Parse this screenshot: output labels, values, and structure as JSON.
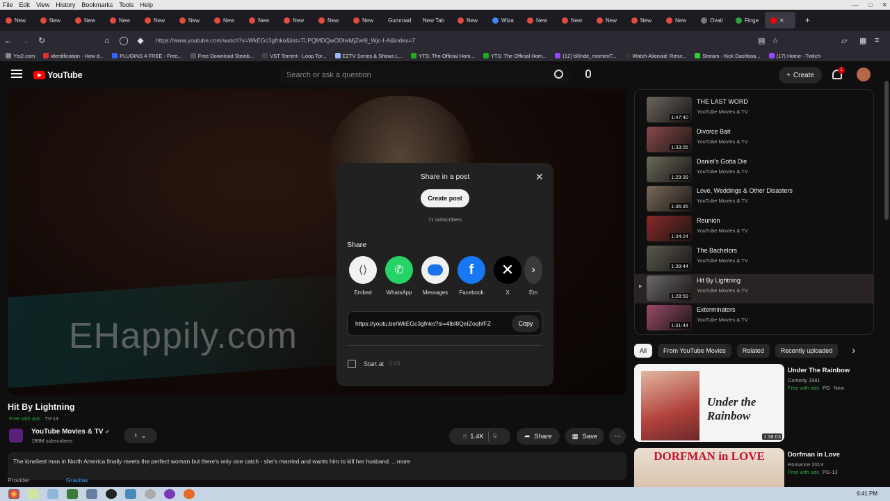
{
  "menubar": {
    "items": [
      "File",
      "Edit",
      "View",
      "History",
      "Bookmarks",
      "Tools",
      "Help"
    ]
  },
  "tabs": [
    "New",
    "New",
    "New",
    "New",
    "New",
    "New",
    "New",
    "New",
    "New",
    "New",
    "New",
    "Gumroad",
    "New Tab",
    "New",
    "Wiza",
    "New",
    "New",
    "New",
    "New",
    "New",
    "Ovati",
    "Finge"
  ],
  "browser": {
    "url": "https://www.youtube.com/watch?v=WkEGc3gfnko&list=TLPQMDQwODIwMjZwi9_Wjc-I-A&index=7"
  },
  "bookmarks": [
    "Yts2.com",
    "identification - How d...",
    "PLUGINS 4 FREE - Free...",
    "Free Download Steinb...",
    "VST Torrent - Loop Tor...",
    "EZTV Series & Shows L...",
    "YTS: The Official Hom...",
    "YTS: The Official Hom...",
    "(12) bl0nde_momenT...",
    "Watch Alienoid: Retur...",
    "Stream - Kick Dashboa...",
    "(17) Home - Twitch"
  ],
  "header": {
    "logo": "YouTube",
    "search_placeholder": "Search or ask a question",
    "create": "Create",
    "notif_count": "1"
  },
  "video": {
    "watermark": "EHappily.com",
    "title": "Hit By Lightning",
    "free": "Free with ads",
    "rating": "TV-14",
    "channel": "YouTube Movies & TV",
    "subs": "199M subscribers",
    "likes": "1.4K",
    "share": "Share",
    "save": "Save",
    "description": "The loneliest man in North America finally meets the perfect woman but there's only one catch - she's married and wants him to kill her husband. ...more",
    "provider_label": "Provider",
    "provider": "Gravitas"
  },
  "modal": {
    "title": "Share in a post",
    "create_post": "Create post",
    "subs": "71 subscribers",
    "share_label": "Share",
    "targets": [
      {
        "label": "Embed",
        "color": "#f1f1f1"
      },
      {
        "label": "WhatsApp",
        "color": "#25d366"
      },
      {
        "label": "Messages",
        "color": "#1a73e8"
      },
      {
        "label": "Facebook",
        "color": "#1877f2"
      },
      {
        "label": "X",
        "color": "#000000"
      },
      {
        "label": "Em",
        "color": "#3a3a3a"
      }
    ],
    "link": "https://youtu.be/WkEGc3gfnko?si=4lbI8QeIZoqhfFZ",
    "copy": "Copy",
    "start_at": "Start at",
    "start_time": "0:03"
  },
  "playlist": [
    {
      "title": "THE LAST WORD",
      "channel": "YouTube Movies & TV",
      "duration": "1:47:40",
      "thumb": "#6b6560"
    },
    {
      "title": "Divorce Bait",
      "channel": "YouTube Movies & TV",
      "duration": "1:33:05",
      "thumb": "#8a4a4a"
    },
    {
      "title": "Daniel's Gotta Die",
      "channel": "YouTube Movies & TV",
      "duration": "1:29:39",
      "thumb": "#6a6a5a"
    },
    {
      "title": "Love, Weddings & Other Disasters",
      "channel": "YouTube Movies & TV",
      "duration": "1:36:35",
      "thumb": "#7a6a5a"
    },
    {
      "title": "Reunion",
      "channel": "YouTube Movies & TV",
      "duration": "1:34:24",
      "thumb": "#8a2a2a"
    },
    {
      "title": "The Bachelors",
      "channel": "YouTube Movies & TV",
      "duration": "1:39:44",
      "thumb": "#5a5a50"
    },
    {
      "title": "Hit By Lightning",
      "channel": "YouTube Movies & TV",
      "duration": "1:28:59",
      "thumb": "#6a6a6a"
    },
    {
      "title": "Exterminators",
      "channel": "YouTube Movies & TV",
      "duration": "1:31:44",
      "thumb": "#9a4a6a"
    }
  ],
  "chips": [
    "All",
    "From YouTube Movies",
    "Related",
    "Recently uploaded"
  ],
  "recommendations": [
    {
      "title": "Under The Rainbow",
      "meta": "Comedy 1981",
      "free": "Free with ads",
      "b1": "PG",
      "b2": "New",
      "duration": "1:38:03",
      "thumb_text": "Under the Rainbow"
    },
    {
      "title": "Dorfman in Love",
      "meta": "Romance 2013",
      "free": "Free with ads",
      "b1": "PG-13",
      "b2": "",
      "duration": "",
      "thumb_text": "DORFMAN in LOVE"
    }
  ],
  "taskbar": {
    "clock": "6:41 PM"
  }
}
